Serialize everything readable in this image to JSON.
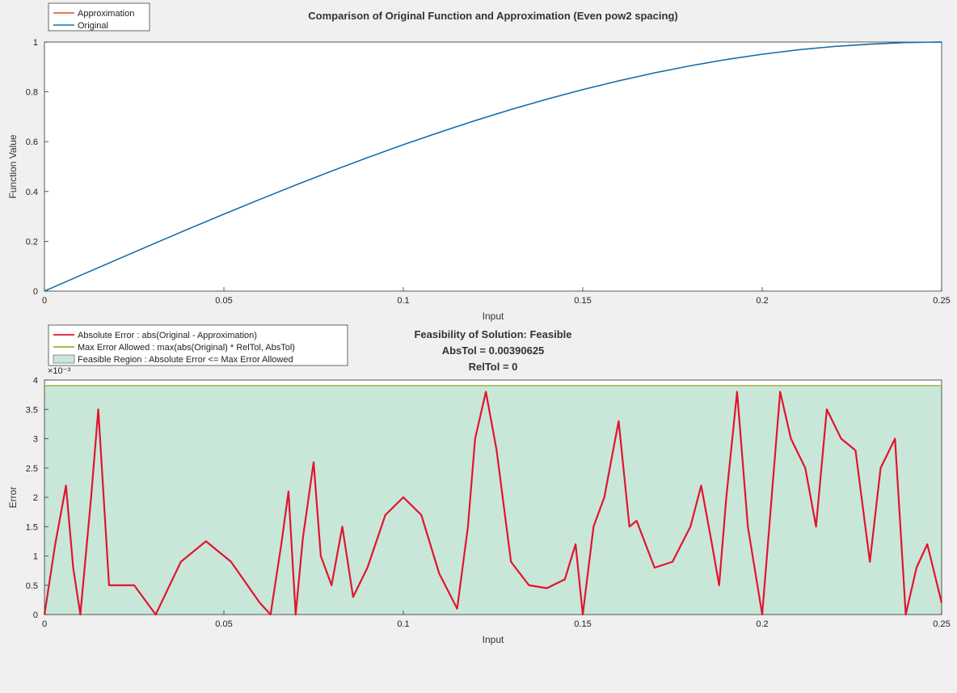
{
  "chart_data": [
    {
      "type": "line",
      "title": "Comparison of Original Function and Approximation (Even pow2 spacing)",
      "xlabel": "Input",
      "ylabel": "Function Value",
      "xlim": [
        0,
        0.25
      ],
      "ylim": [
        0,
        1.0
      ],
      "xticks": [
        0,
        0.05,
        0.1,
        0.15,
        0.2,
        0.25
      ],
      "yticks": [
        0,
        0.2,
        0.4,
        0.6,
        0.8,
        1.0
      ],
      "series": [
        {
          "name": "Approximation",
          "color": "#d95319",
          "x": [
            0,
            0.01,
            0.02,
            0.03,
            0.04,
            0.05,
            0.06,
            0.07,
            0.08,
            0.09,
            0.1,
            0.11,
            0.12,
            0.13,
            0.14,
            0.15,
            0.16,
            0.17,
            0.18,
            0.19,
            0.2,
            0.21,
            0.22,
            0.23,
            0.24,
            0.25
          ],
          "y": [
            0,
            0.063,
            0.125,
            0.187,
            0.249,
            0.309,
            0.368,
            0.426,
            0.482,
            0.536,
            0.588,
            0.637,
            0.685,
            0.729,
            0.771,
            0.809,
            0.844,
            0.876,
            0.905,
            0.93,
            0.951,
            0.969,
            0.982,
            0.991,
            0.998,
            1.0
          ]
        },
        {
          "name": "Original",
          "color": "#0072bd",
          "x": [
            0,
            0.01,
            0.02,
            0.03,
            0.04,
            0.05,
            0.06,
            0.07,
            0.08,
            0.09,
            0.1,
            0.11,
            0.12,
            0.13,
            0.14,
            0.15,
            0.16,
            0.17,
            0.18,
            0.19,
            0.2,
            0.21,
            0.22,
            0.23,
            0.24,
            0.25
          ],
          "y": [
            0,
            0.0628,
            0.1253,
            0.1874,
            0.2487,
            0.309,
            0.3681,
            0.4258,
            0.4818,
            0.5358,
            0.5878,
            0.6374,
            0.6845,
            0.729,
            0.7705,
            0.809,
            0.8443,
            0.8763,
            0.9048,
            0.9298,
            0.9511,
            0.9686,
            0.9823,
            0.9921,
            0.998,
            1.0
          ]
        }
      ],
      "legend": [
        "Approximation",
        "Original"
      ]
    },
    {
      "type": "line",
      "title_lines": [
        "Feasibility of Solution: Feasible",
        "AbsTol = 0.00390625",
        "RelTol = 0"
      ],
      "xlabel": "Input",
      "ylabel": "Error",
      "xlim": [
        0,
        0.25
      ],
      "ylim": [
        0,
        0.004
      ],
      "xticks": [
        0,
        0.05,
        0.1,
        0.15,
        0.2,
        0.25
      ],
      "yticks": [
        0,
        0.0005,
        0.001,
        0.0015,
        0.002,
        0.0025,
        0.003,
        0.0035,
        0.004
      ],
      "ytick_labels": [
        "0",
        "0.5",
        "1",
        "1.5",
        "2",
        "2.5",
        "3",
        "3.5",
        "4"
      ],
      "y_exponent": "×10⁻³",
      "feasible_fill": "#c9e7d8",
      "max_error": 0.00390625,
      "series": [
        {
          "name": "Absolute Error : abs(Original - Approximation)",
          "color": "#e2142f",
          "x": [
            0,
            0.003,
            0.006,
            0.008,
            0.01,
            0.013,
            0.015,
            0.018,
            0.025,
            0.031,
            0.038,
            0.045,
            0.052,
            0.06,
            0.063,
            0.066,
            0.068,
            0.07,
            0.072,
            0.075,
            0.077,
            0.08,
            0.083,
            0.086,
            0.09,
            0.095,
            0.1,
            0.105,
            0.11,
            0.115,
            0.118,
            0.12,
            0.123,
            0.126,
            0.13,
            0.135,
            0.14,
            0.145,
            0.148,
            0.15,
            0.153,
            0.156,
            0.16,
            0.163,
            0.165,
            0.17,
            0.175,
            0.18,
            0.183,
            0.186,
            0.188,
            0.19,
            0.193,
            0.196,
            0.2,
            0.205,
            0.208,
            0.212,
            0.215,
            0.218,
            0.222,
            0.226,
            0.23,
            0.233,
            0.237,
            0.24,
            0.243,
            0.246,
            0.25
          ],
          "y": [
            0,
            0.0012,
            0.0022,
            0.0008,
            0.0,
            0.002,
            0.0035,
            0.0005,
            0.0005,
            0.0,
            0.0009,
            0.00125,
            0.0009,
            0.0002,
            0.0,
            0.0012,
            0.0021,
            0.0,
            0.0013,
            0.0026,
            0.001,
            0.0005,
            0.0015,
            0.0003,
            0.0008,
            0.0017,
            0.002,
            0.0017,
            0.0007,
            0.0001,
            0.0015,
            0.003,
            0.0038,
            0.0028,
            0.0009,
            0.0005,
            0.00045,
            0.0006,
            0.0012,
            0.0,
            0.0015,
            0.002,
            0.0033,
            0.0015,
            0.0016,
            0.0008,
            0.0009,
            0.0015,
            0.0022,
            0.0012,
            0.0005,
            0.002,
            0.0038,
            0.0015,
            0.0,
            0.0038,
            0.003,
            0.0025,
            0.0015,
            0.0035,
            0.003,
            0.0028,
            0.0009,
            0.0025,
            0.003,
            0.0,
            0.0008,
            0.0012,
            0.0002
          ]
        },
        {
          "name": "Max Error Allowed : max(abs(Original) * RelTol, AbsTol)",
          "color": "#9fae3a",
          "x": [
            0,
            0.25
          ],
          "y": [
            0.00390625,
            0.00390625
          ]
        },
        {
          "name": "Feasible Region : Absolute Error <= Max Error Allowed",
          "color": "#c9e7d8"
        }
      ],
      "legend": [
        "Absolute Error : abs(Original - Approximation)",
        "Max Error Allowed : max(abs(Original) * RelTol, AbsTol)",
        "Feasible Region : Absolute Error <= Max Error Allowed"
      ]
    }
  ]
}
